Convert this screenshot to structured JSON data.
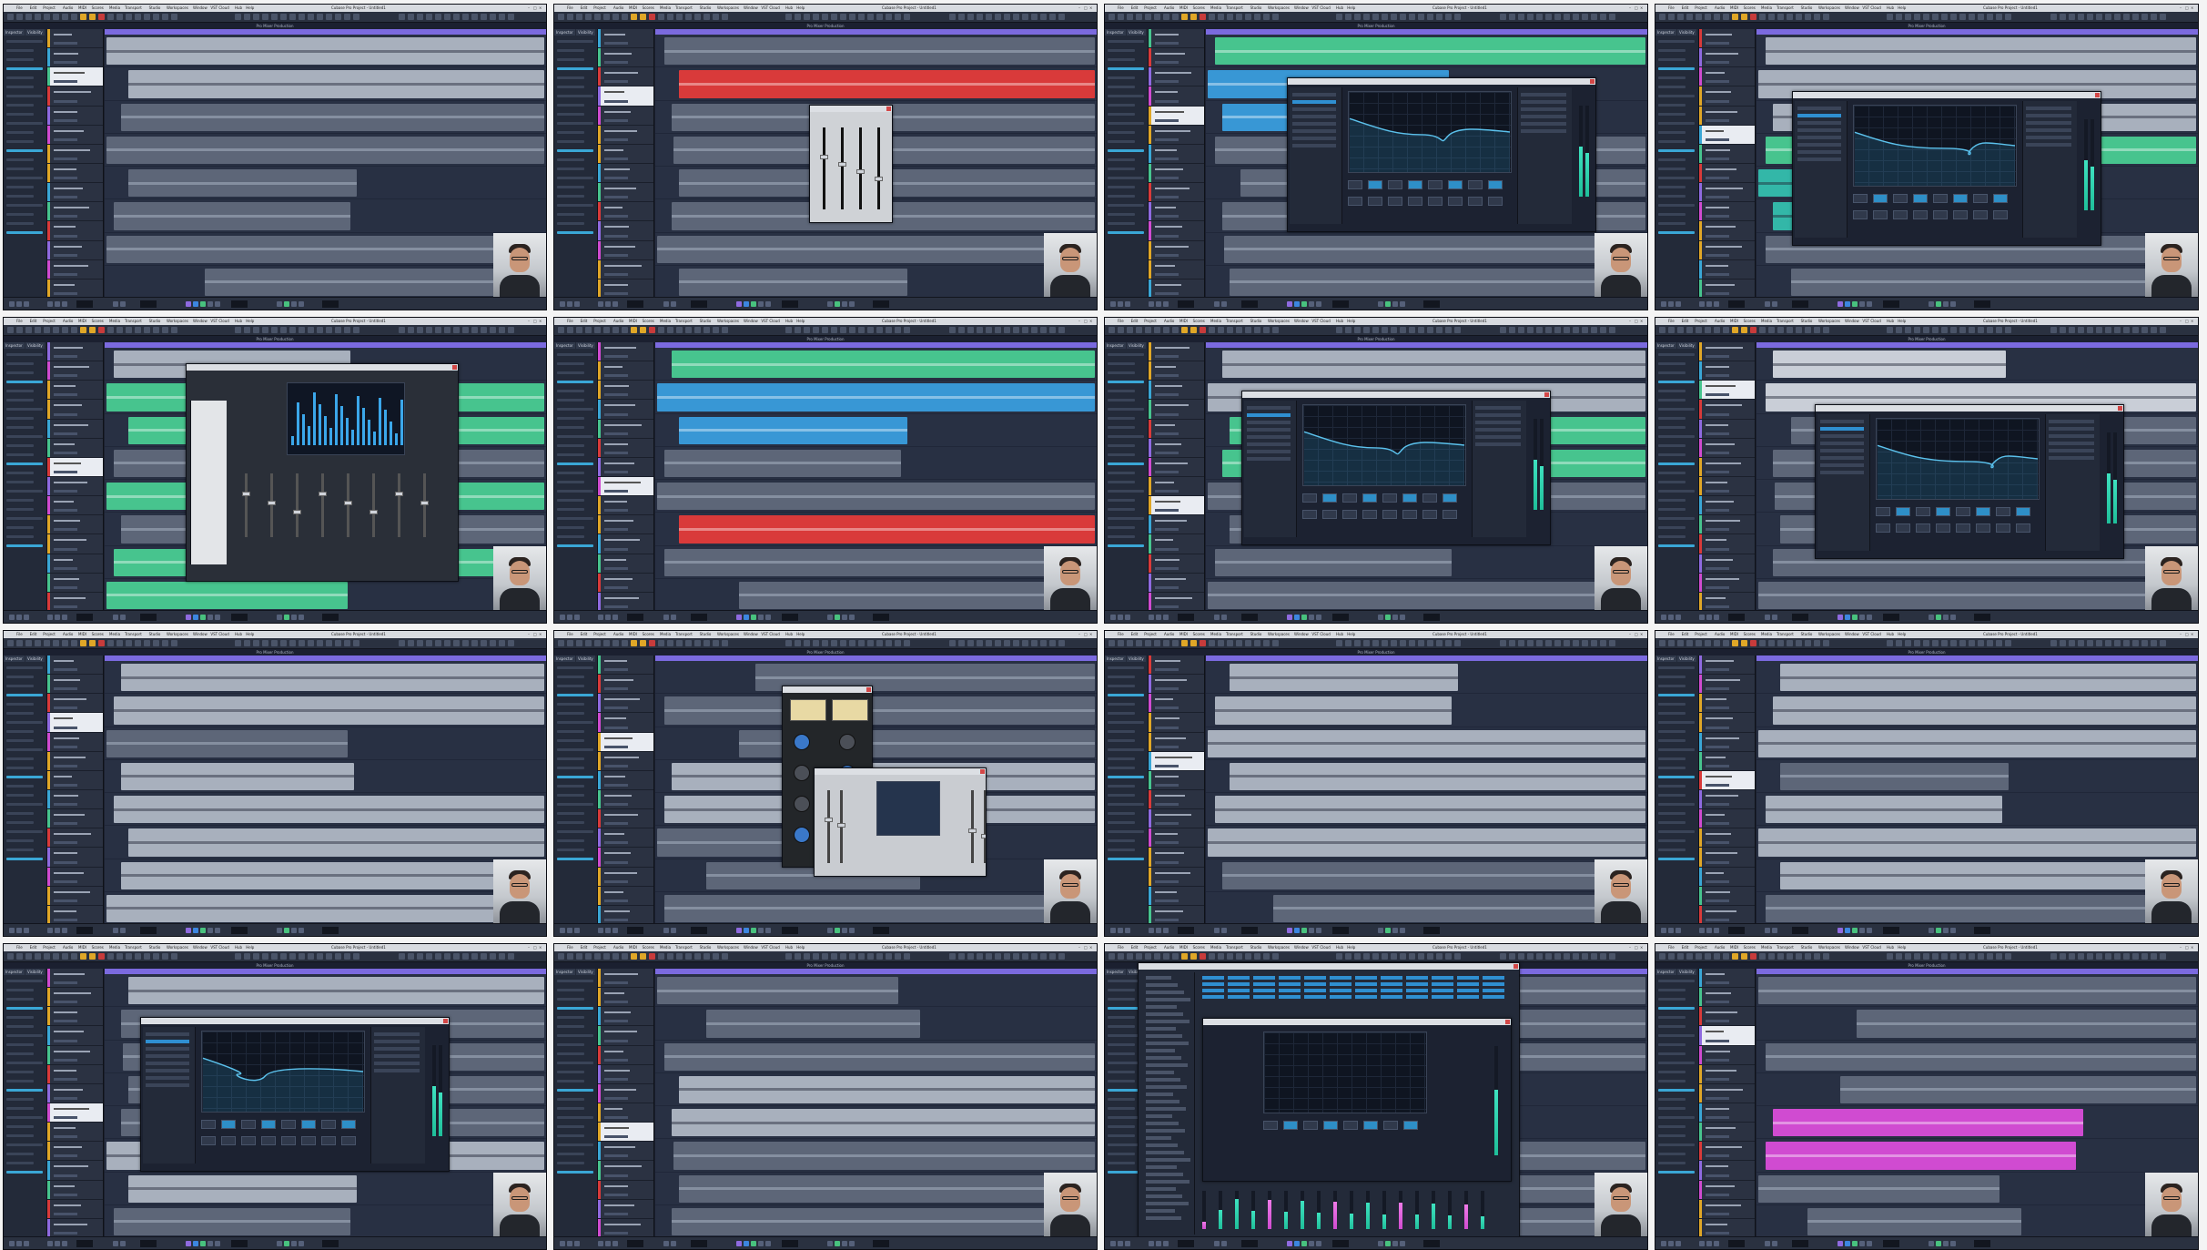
{
  "menu_items": [
    "File",
    "Edit",
    "Project",
    "Audio",
    "MIDI",
    "Scores",
    "Media",
    "Transport",
    "Studio",
    "Workspaces",
    "Window",
    "VST Cloud",
    "Hub",
    "Help"
  ],
  "window_title": "Cubase Pro Project - Untitled1",
  "window_controls": [
    "–",
    "□",
    "×"
  ],
  "project_title": "Pro Mixer Production",
  "inspector_tabs": [
    "Inspector",
    "Visibility"
  ],
  "colors": {
    "ruler": "#7b6adf",
    "selected_track": "#e9ecf2",
    "accent_yellow": "#e0a727",
    "record_red": "#c83b3b",
    "meter_teal": "#1fbf9a",
    "clip_gray": "#a8b0bd",
    "clip_red": "#d93a3a",
    "clip_green": "#47c48e",
    "clip_blue": "#3897d5",
    "clip_pink": "#d04bd1"
  },
  "icons": [
    "play-icon",
    "stop-icon",
    "record-icon",
    "cycle-icon",
    "close-icon",
    "webcam-video"
  ],
  "tiles": [
    {
      "plugin": "none",
      "lanes": [
        "gray",
        "gray",
        "dark",
        "dark",
        "dark",
        "dark",
        "dark",
        "dark"
      ]
    },
    {
      "plugin": "channel-strip",
      "lanes": [
        "dark",
        "red",
        "dark",
        "dark",
        "dark",
        "dark",
        "dark",
        "dark"
      ]
    },
    {
      "plugin": "eq",
      "lanes": [
        "green",
        "blue",
        "blue",
        "dark",
        "dark",
        "dark",
        "dark",
        "dark"
      ]
    },
    {
      "plugin": "eq",
      "lanes": [
        "gray",
        "gray",
        "gray",
        "green",
        "teal",
        "teal",
        "dark",
        "dark"
      ]
    },
    {
      "plugin": "mixer",
      "lanes": [
        "gray",
        "green",
        "green",
        "dark",
        "green",
        "dark",
        "green",
        "green"
      ]
    },
    {
      "plugin": "none",
      "lanes": [
        "green",
        "blue",
        "blue",
        "dark",
        "dark",
        "red",
        "dark",
        "dark"
      ]
    },
    {
      "plugin": "eq",
      "lanes": [
        "gray",
        "gray",
        "green",
        "green",
        "dark",
        "dark",
        "dark",
        "dark"
      ]
    },
    {
      "plugin": "eq",
      "lanes": [
        "light",
        "light",
        "dark",
        "dark",
        "dark",
        "dark",
        "dark",
        "dark"
      ]
    },
    {
      "plugin": "none",
      "lanes": [
        "gray",
        "gray",
        "dark",
        "gray",
        "gray",
        "gray",
        "gray",
        "gray"
      ]
    },
    {
      "plugin": "compressor",
      "lanes": [
        "dark",
        "dark",
        "dark",
        "gray",
        "gray",
        "dark",
        "dark",
        "dark"
      ]
    },
    {
      "plugin": "none",
      "lanes": [
        "gray",
        "gray",
        "gray",
        "gray",
        "gray",
        "gray",
        "dark",
        "dark"
      ]
    },
    {
      "plugin": "none",
      "lanes": [
        "gray",
        "gray",
        "gray",
        "dark",
        "gray",
        "gray",
        "gray",
        "dark"
      ]
    },
    {
      "plugin": "eq",
      "lanes": [
        "gray",
        "dark",
        "dark",
        "dark",
        "dark",
        "gray",
        "gray",
        "dark"
      ]
    },
    {
      "plugin": "none",
      "lanes": [
        "dark",
        "dark",
        "dark",
        "gray",
        "gray",
        "dark",
        "dark",
        "dark"
      ]
    },
    {
      "plugin": "mixconsole",
      "lanes": [
        "dark",
        "dark",
        "dark",
        "dark",
        "dark",
        "dark",
        "dark",
        "dark"
      ]
    },
    {
      "plugin": "none",
      "lanes": [
        "dark",
        "dark",
        "dark",
        "dark",
        "pink",
        "pink",
        "dark",
        "dark"
      ]
    }
  ]
}
